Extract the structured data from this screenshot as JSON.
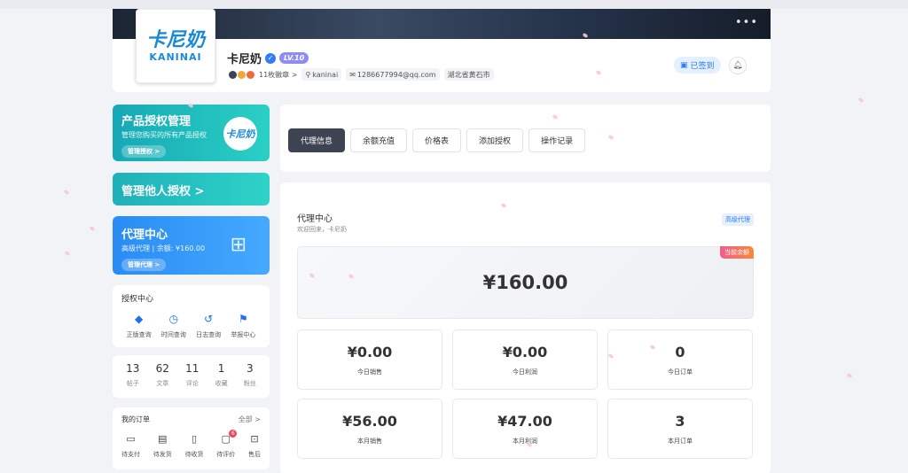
{
  "profile": {
    "more_icon": "more-horizontal-icon",
    "logo_cn": "卡尼奶",
    "logo_en": "KANINAI",
    "username": "卡尼奶",
    "level_badge": "LV.10",
    "medals": "11枚徽章 >",
    "handle": "kaninai",
    "email": "1286677994@qq.com",
    "location": "湖北省黄石市",
    "signed_label": "已签到"
  },
  "left": {
    "product_card": {
      "title": "产品授权管理",
      "subtitle": "管理您购买的所有产品授权",
      "button": "管理授权 >",
      "logo": "卡尼奶"
    },
    "others_card": {
      "title": "管理他人授权 >"
    },
    "agent_card": {
      "title": "代理中心",
      "subtitle": "高级代理 | 余额: ¥160.00",
      "button": "管理代理 >"
    },
    "auth_center": {
      "heading": "授权中心",
      "items": [
        {
          "label": "正版查询",
          "icon": "shield-check-icon"
        },
        {
          "label": "时间查询",
          "icon": "clock-icon"
        },
        {
          "label": "日志查询",
          "icon": "history-icon"
        },
        {
          "label": "举报中心",
          "icon": "flag-icon"
        }
      ]
    },
    "stats": [
      {
        "value": "13",
        "label": "帖子"
      },
      {
        "value": "62",
        "label": "文章"
      },
      {
        "value": "11",
        "label": "评论"
      },
      {
        "value": "1",
        "label": "收藏"
      },
      {
        "value": "3",
        "label": "粉丝"
      }
    ],
    "orders": {
      "heading": "我的订单",
      "all": "全部 >",
      "items": [
        {
          "label": "待支付",
          "icon": "wallet-icon"
        },
        {
          "label": "待发货",
          "icon": "package-icon"
        },
        {
          "label": "待收货",
          "icon": "truck-icon"
        },
        {
          "label": "待评价",
          "icon": "comment-icon",
          "badge": "6"
        },
        {
          "label": "售后",
          "icon": "refund-icon"
        }
      ]
    }
  },
  "tabs": [
    "代理信息",
    "余额充值",
    "价格表",
    "添加授权",
    "操作记录"
  ],
  "agent_panel": {
    "title": "代理中心",
    "welcome": "欢迎回来，卡尼奶",
    "level": "高级代理",
    "balance": "¥160.00",
    "balance_tag": "当前余额",
    "cards": [
      {
        "value": "¥0.00",
        "label": "今日销售"
      },
      {
        "value": "¥0.00",
        "label": "今日利润"
      },
      {
        "value": "0",
        "label": "今日订单"
      },
      {
        "value": "¥56.00",
        "label": "本月销售"
      },
      {
        "value": "¥47.00",
        "label": "本月利润"
      },
      {
        "value": "3",
        "label": "本月订单"
      }
    ]
  }
}
